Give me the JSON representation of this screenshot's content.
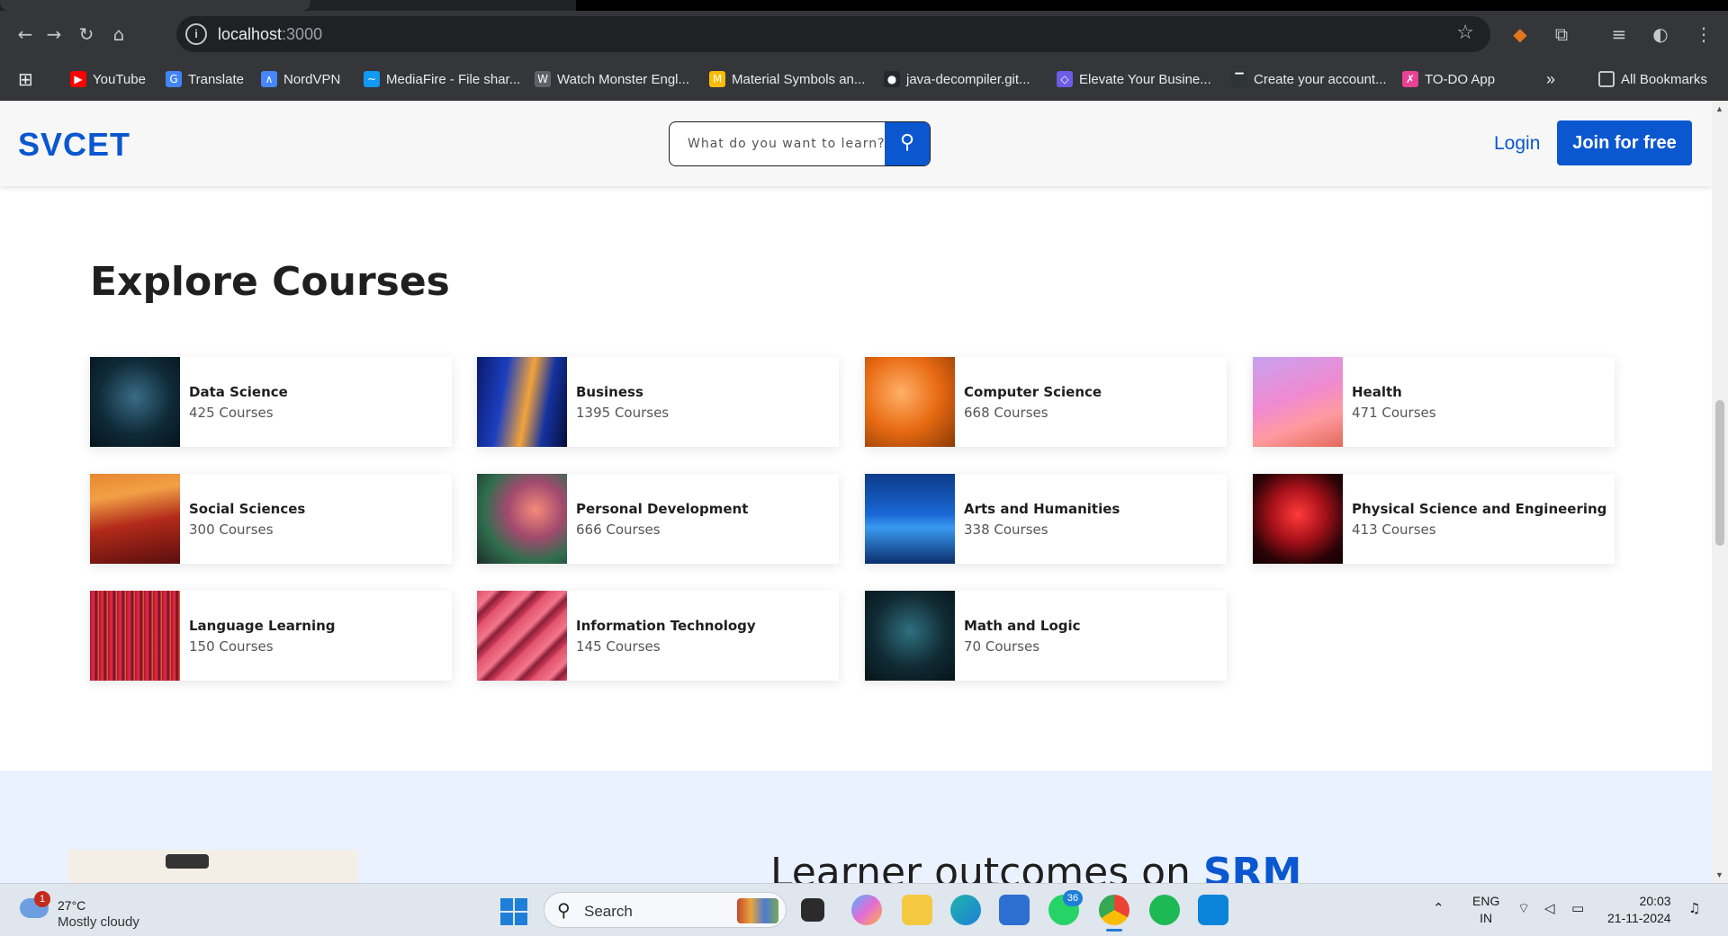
{
  "browser": {
    "url_host": "localhost",
    "url_port": ":3000",
    "bookmarks": [
      {
        "label": "YouTube",
        "color": "#ff0000"
      },
      {
        "label": "Translate",
        "color": "#4285f4"
      },
      {
        "label": "NordVPN",
        "color": "#4687ff"
      },
      {
        "label": "MediaFire - File shar...",
        "color": "#1299f3"
      },
      {
        "label": "Watch Monster Engl...",
        "color": "#9aa0a6"
      },
      {
        "label": "Material Symbols an...",
        "color": "#fbbc04"
      },
      {
        "label": "java-decompiler.git...",
        "color": "#24292e"
      },
      {
        "label": "Elevate Your Busine...",
        "color": "#6c5ce7"
      },
      {
        "label": "Create your account...",
        "color": "#2d3436"
      },
      {
        "label": "TO-DO App",
        "color": "#e84393"
      }
    ],
    "all_bookmarks": "All Bookmarks"
  },
  "site": {
    "logo": "SVCET",
    "search_placeholder": "What do you want to learn?",
    "login": "Login",
    "join": "Join for free"
  },
  "explore": {
    "title": "Explore Courses",
    "categories": [
      {
        "name": "Data Science",
        "count": "425 Courses",
        "thumb": "network-blue"
      },
      {
        "name": "Business",
        "count": "1395 Courses",
        "thumb": "swirl-blue-orange"
      },
      {
        "name": "Computer Science",
        "count": "668 Courses",
        "thumb": "orange-leaves"
      },
      {
        "name": "Health",
        "count": "471 Courses",
        "thumb": "pink-streaks"
      },
      {
        "name": "Social Sciences",
        "count": "300 Courses",
        "thumb": "orange-red-waves"
      },
      {
        "name": "Personal Development",
        "count": "666 Courses",
        "thumb": "green-pink-blur"
      },
      {
        "name": "Arts and Humanities",
        "count": "338 Courses",
        "thumb": "blue-particles"
      },
      {
        "name": "Physical Science and Engineering",
        "count": "413 Courses",
        "thumb": "red-fiber-dome"
      },
      {
        "name": "Language Learning",
        "count": "150 Courses",
        "thumb": "red-light-streaks"
      },
      {
        "name": "Information Technology",
        "count": "145 Courses",
        "thumb": "pink-fins"
      },
      {
        "name": "Math and Logic",
        "count": "70 Courses",
        "thumb": "network-teal"
      }
    ]
  },
  "outcomes": {
    "heading_prefix": "Learner outcomes on ",
    "heading_brand": "SRM"
  },
  "taskbar": {
    "badge": "1",
    "temperature": "27°C",
    "condition": "Mostly cloudy",
    "search_label": "Search",
    "whatsapp_badge": "36",
    "lang_1": "ENG",
    "lang_2": "IN",
    "time": "20:03",
    "date": "21-11-2024"
  },
  "colors": {
    "brand": "#0b57d0",
    "outcomes_bg": "#ebf2ff"
  }
}
